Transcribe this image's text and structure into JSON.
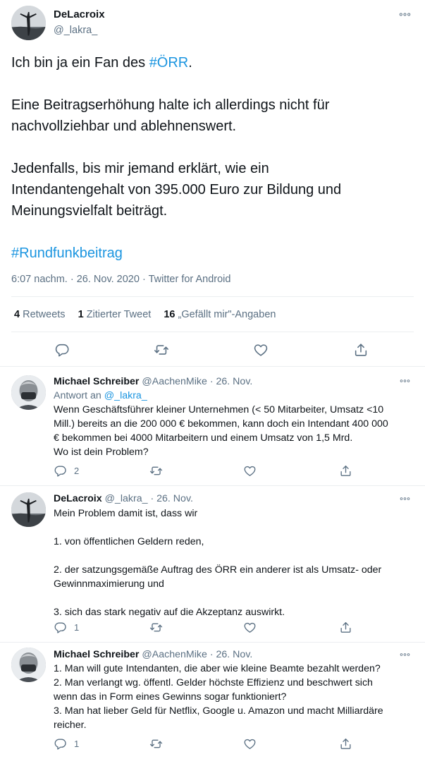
{
  "main_tweet": {
    "author_name": "DeLacroix",
    "handle": "@_lakra_",
    "line1_prefix": "Ich bin ja ein Fan des ",
    "line1_hashtag": "#ÖRR",
    "line1_suffix": ".",
    "para2_line1": "Eine Beitragserhöhung halte ich allerdings nicht für",
    "para2_line2": "nachvollziehbar und ablehnenswert.",
    "para3_line1": "Jedenfalls, bis mir jemand erklärt, wie ein",
    "para3_line2": "Intendantengehalt von 395.000 Euro zur Bildung und",
    "para3_line3": "Meinungsvielfalt beiträgt.",
    "hashtag2": "#Rundfunkbeitrag",
    "time": "6:07 nachm.",
    "date": "26. Nov. 2020",
    "source": "Twitter for Android",
    "retweets_count": "4",
    "retweets_label": "Retweets",
    "quotes_count": "1",
    "quotes_label": "Zitierter Tweet",
    "likes_count": "16",
    "likes_label": "„Gefällt mir\"-Angaben"
  },
  "replies": [
    {
      "author_name": "Michael Schreiber",
      "handle": "@AachenMike",
      "date": "26. Nov.",
      "reply_to_label": "Antwort an",
      "reply_to_handle": "@_lakra_",
      "lines": [
        "Wenn Geschäftsführer kleiner Unternehmen (< 50 Mitarbeiter, Umsatz <10",
        "Mill.) bereits an die 200 000 € bekommen, kann doch ein Intendant 400 000",
        "€ bekommen bei 4000 Mitarbeitern und einem Umsatz von 1,5 Mrd.",
        "Wo ist dein Problem?"
      ],
      "reply_count": "2"
    },
    {
      "author_name": "DeLacroix",
      "handle": "@_lakra_",
      "date": "26. Nov.",
      "lines": [
        "Mein Problem damit ist, dass wir",
        "1. von öffentlichen Geldern reden,",
        "2. der satzungsgemäße Auftrag des ÖRR ein anderer ist als Umsatz- oder",
        "Gewinnmaximierung und",
        "3. sich das stark negativ auf die Akzeptanz auswirkt."
      ],
      "reply_count": "1"
    },
    {
      "author_name": "Michael Schreiber",
      "handle": "@AachenMike",
      "date": "26. Nov.",
      "lines": [
        "1. Man will gute Intendanten, die aber wie kleine Beamte bezahlt werden?",
        "2. Man verlangt wg. öffentl. Gelder höchste Effizienz und beschwert sich",
        "wenn das in Form eines Gewinns sogar funktioniert?",
        "3. Man hat lieber Geld für Netflix, Google u. Amazon und macht Milliardäre",
        "reicher."
      ],
      "reply_count": "1"
    }
  ],
  "separators": {
    "dot": "·"
  },
  "icons": [
    "more-icon",
    "reply-icon",
    "retweet-icon",
    "like-icon",
    "share-icon"
  ],
  "colors": {
    "accent": "#1b95e0",
    "secondary_text": "#5b7083",
    "text": "#0f1419"
  }
}
